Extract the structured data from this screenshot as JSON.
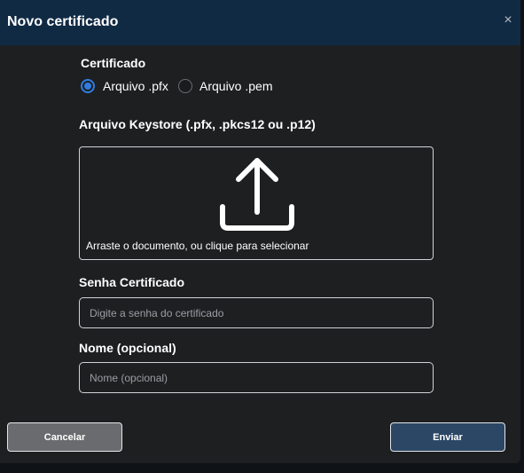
{
  "dialog": {
    "title": "Novo certificado",
    "close_symbol": "×"
  },
  "certificate_type": {
    "label": "Certificado",
    "options": [
      {
        "label": "Arquivo .pfx",
        "selected": true
      },
      {
        "label": "Arquivo .pem",
        "selected": false
      }
    ]
  },
  "keystore": {
    "label": "Arquivo Keystore (.pfx, .pkcs12 ou .p12)",
    "dropzone_text": "Arraste o documento, ou clique para selecionar",
    "icon": "upload-icon"
  },
  "password": {
    "label": "Senha Certificado",
    "placeholder": "Digite a senha do certificado",
    "value": ""
  },
  "name": {
    "label": "Nome (opcional)",
    "placeholder": "Nome (opcional)",
    "value": ""
  },
  "actions": {
    "cancel_label": "Cancelar",
    "submit_label": "Enviar"
  },
  "colors": {
    "header_bg": "#112a44",
    "body_bg": "#1e1f21",
    "accent": "#2f7de1",
    "submit_bg": "#2c4766",
    "cancel_bg": "#6a6b6e"
  }
}
